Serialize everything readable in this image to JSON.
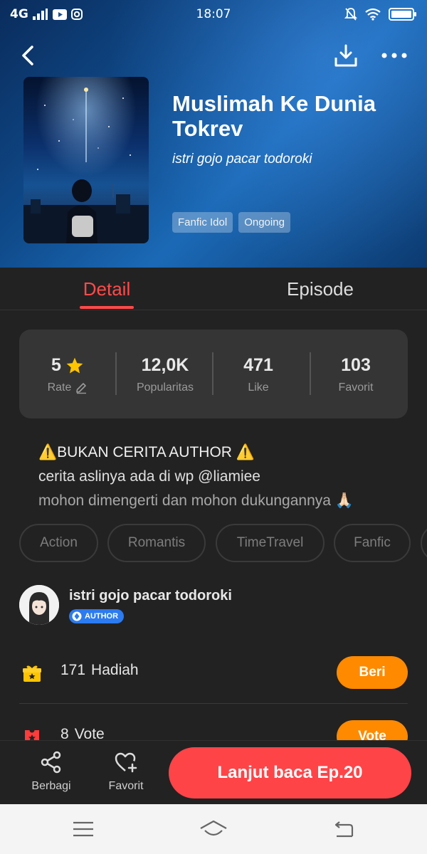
{
  "status_bar": {
    "network": "4G",
    "time": "18:07"
  },
  "book": {
    "title": "Muslimah Ke Dunia Tokrev",
    "author": "istri gojo pacar todoroki",
    "tags": [
      "Fanfic Idol",
      "Ongoing"
    ]
  },
  "tabs": {
    "detail": "Detail",
    "episode": "Episode"
  },
  "stats": {
    "rate": {
      "value": "5",
      "label": "Rate"
    },
    "popularity": {
      "value": "12,0K",
      "label": "Popularitas"
    },
    "like": {
      "value": "471",
      "label": "Like"
    },
    "favorite": {
      "value": "103",
      "label": "Favorit"
    }
  },
  "description": {
    "line1": "⚠️BUKAN CERITA AUTHOR ⚠️",
    "line2": "cerita aslinya ada di wp @liamiee",
    "line3": "mohon dimengerti dan mohon dukungannya 🙏🏻"
  },
  "genres": [
    "Action",
    "Romantis",
    "TimeTravel",
    "Fanfic"
  ],
  "author_card": {
    "name": "istri gojo pacar todoroki",
    "badge": "AUTHOR"
  },
  "gift": {
    "count": "171",
    "label": "Hadiah",
    "button": "Beri"
  },
  "vote": {
    "count": "8",
    "label": "Vote",
    "button": "Vote"
  },
  "bottom_bar": {
    "share_label": "Berbagi",
    "favorite_label": "Favorit",
    "read_button": "Lanjut baca Ep.20"
  },
  "colors": {
    "accent_red": "#ff4a4a",
    "accent_orange": "#ff8a00",
    "background": "#222222"
  }
}
